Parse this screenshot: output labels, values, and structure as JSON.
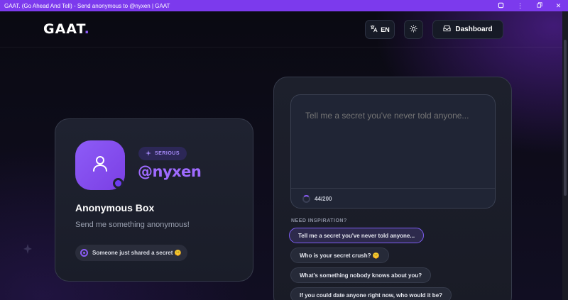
{
  "window": {
    "title": "GAAT. (Go Ahead And Tell) - Send anonymous to @nyxen | GAAT",
    "controls": [
      "extension-icon",
      "more-icon",
      "restore-icon",
      "close-icon"
    ]
  },
  "header": {
    "logo_text": "GAAT",
    "logo_dot": ".",
    "lang_label": "EN",
    "dashboard_label": "Dashboard"
  },
  "profile": {
    "badge": "SERIOUS",
    "username": "@nyxen",
    "box_title": "Anonymous Box",
    "box_subtitle": "Send me something anonymous!",
    "activity": "Someone just shared a secret 🤫"
  },
  "composer": {
    "placeholder": "Tell me a secret you've never told anyone...",
    "counter": "44/200",
    "inspiration_label": "NEED INSPIRATION?",
    "suggestions": [
      "Tell me a secret you've never told anyone...",
      "Who is your secret crush? 🤫",
      "What's something nobody knows about you?",
      "If you could date anyone right now, who would it be?"
    ]
  },
  "colors": {
    "accent": "#8b5cf6",
    "titlebar": "#7c3aed",
    "background": "#0b0b14"
  }
}
